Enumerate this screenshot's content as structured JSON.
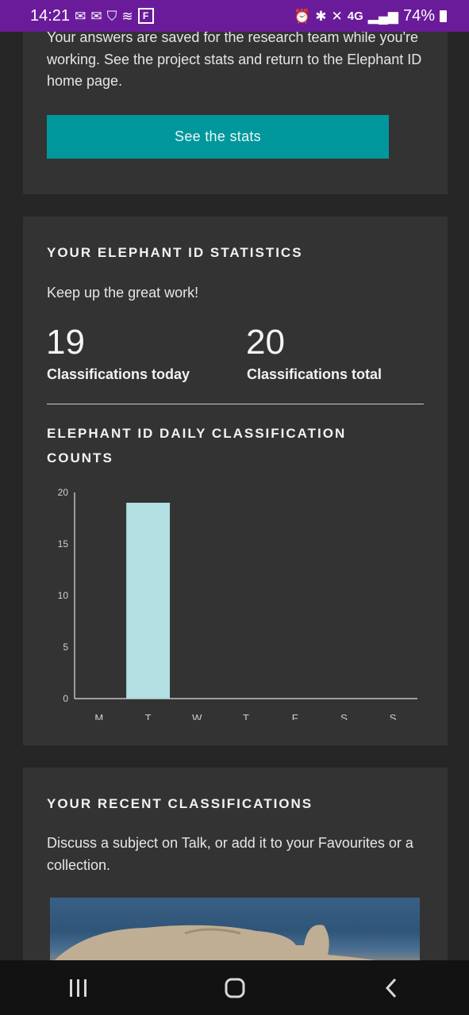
{
  "status_bar": {
    "time": "14:21",
    "left_icons": [
      "mail-icon",
      "mail-icon",
      "shield-icon",
      "wifi-icon"
    ],
    "box_letter": "F",
    "network": "4G",
    "battery": "74%"
  },
  "intro_card": {
    "text": "Your answers are saved for the research team while you're working. See the project stats and return to the Elephant ID home page.",
    "button_label": "See the stats"
  },
  "stats_card": {
    "heading": "YOUR ELEPHANT ID STATISTICS",
    "message": "Keep up the great work!",
    "today_value": "19",
    "today_label": "Classifications today",
    "total_value": "20",
    "total_label": "Classifications total",
    "chart_heading": "ELEPHANT ID DAILY CLASSIFICATION COUNTS"
  },
  "chart_data": {
    "type": "bar",
    "categories": [
      "M",
      "T",
      "W",
      "T",
      "F",
      "S",
      "S"
    ],
    "values": [
      0,
      19,
      0,
      0,
      0,
      0,
      0
    ],
    "ylim": [
      0,
      20
    ],
    "yticks": [
      0,
      5,
      10,
      15,
      20
    ],
    "bar_color": "#b1dfe2",
    "grid": false
  },
  "recent_card": {
    "heading": "YOUR RECENT CLASSIFICATIONS",
    "text": "Discuss a subject on Talk, or add it to your Favourites or a collection."
  },
  "colors": {
    "status_bar": "#6a1b9a",
    "button": "#00979d",
    "card": "#333333",
    "background": "#262626"
  }
}
